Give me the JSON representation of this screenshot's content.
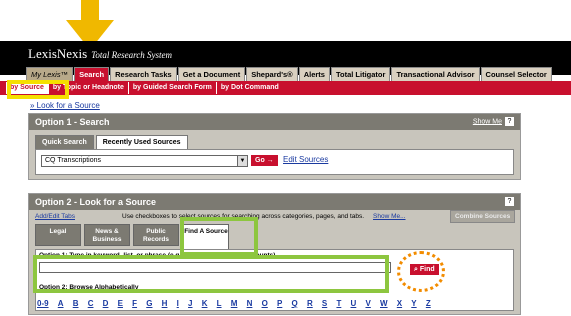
{
  "header": {
    "logo": "LexisNexis",
    "logo_sub": "Total Research System",
    "tabs": [
      "My Lexis™",
      "Search",
      "Research Tasks",
      "Get a Document",
      "Shepard's®",
      "Alerts",
      "Total Litigator",
      "Transactional Advisor",
      "Counsel Selector"
    ],
    "active_tab": "Search"
  },
  "subnav": {
    "items": [
      "by Source",
      "by Topic or Headnote",
      "by Guided Search Form",
      "by Dot Command"
    ],
    "selected": "by Source"
  },
  "look_link": "Look for a Source",
  "option1": {
    "title": "Option 1 - Search",
    "show_me": "Show Me",
    "tabs": [
      "Quick Search",
      "Recently Used Sources"
    ],
    "selected_source": "CQ Transcriptions",
    "go_label": "Go →",
    "edit_sources": "Edit Sources"
  },
  "option2": {
    "title": "Option 2 - Look for a Source",
    "add_edit_tabs": "Add/Edit Tabs",
    "instructions": "Use checkboxes to select sources for searching across categories, pages, and tabs.",
    "show_me": "Show Me...",
    "combine_label": "Combine Sources",
    "categories": [
      "Legal",
      "News & Business",
      "Public Records",
      "Find A Source"
    ],
    "active_category": "Find A Source",
    "option1_text": "Option 1: Type in keyword, list, or phrase (e.g., law review or genetic counts)",
    "find_label": "Find",
    "option2_text": "Option 2: Browse Alphabetically",
    "alphabet": [
      "0-9",
      "A",
      "B",
      "C",
      "D",
      "E",
      "F",
      "G",
      "H",
      "I",
      "J",
      "K",
      "L",
      "M",
      "N",
      "O",
      "P",
      "Q",
      "R",
      "S",
      "T",
      "U",
      "V",
      "W",
      "X",
      "Y",
      "Z"
    ]
  },
  "colors": {
    "brand_red": "#c8102e",
    "highlight_yellow": "#f5e000",
    "highlight_green": "#8dc63f",
    "highlight_orange": "#f28c00"
  }
}
